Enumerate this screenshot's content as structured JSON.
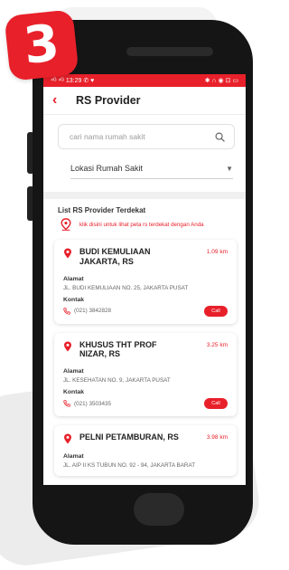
{
  "badge": {
    "number": "3"
  },
  "statusbar": {
    "left": "⁴ᴳ ⁴ᴳ 13:29 ✆ ♥",
    "right": "✱ ∩ ◉ ⊡ ▭"
  },
  "appbar": {
    "back_icon": "chevron-left-icon",
    "title": "RS Provider"
  },
  "search": {
    "placeholder": "cari nama rumah sakit",
    "value": ""
  },
  "location_select": {
    "selected": "Lokasi Rumah Sakit"
  },
  "list": {
    "title": "List RS Provider Terdekat",
    "nearby_link": "klik disini untuk lihat peta rs terdekat dengan Anda"
  },
  "labels": {
    "address": "Alamat",
    "contact": "Kontak",
    "call": "Call"
  },
  "hospitals": [
    {
      "name": "BUDI KEMULIAAN JAKARTA, RS",
      "distance": "1.09 km",
      "address": "JL. BUDI KEMULIAAN NO. 25, JAKARTA PUSAT",
      "phone": "(021) 3842828"
    },
    {
      "name": "KHUSUS THT PROF NIZAR, RS",
      "distance": "3.25 km",
      "address": "JL. KESEHATAN NO. 9, JAKARTA PUSAT",
      "phone": "(021) 3503435"
    },
    {
      "name": "PELNI PETAMBURAN, RS",
      "distance": "3.98 km",
      "address": "JL. AIP II KS TUBUN NO. 92 - 94, JAKARTA BARAT"
    }
  ],
  "colors": {
    "accent": "#e8202a",
    "phone_frame": "#151515"
  }
}
